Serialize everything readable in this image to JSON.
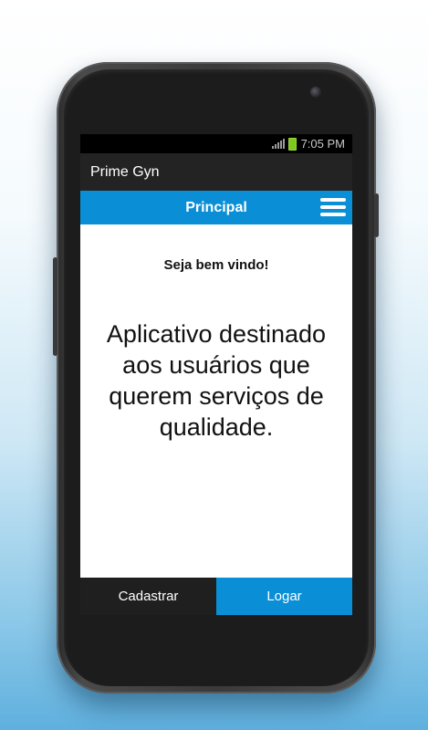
{
  "statusbar": {
    "time": "7:05 PM",
    "signal_icon": "signal-icon",
    "battery_icon": "battery-icon"
  },
  "appbar": {
    "title": "Prime Gyn"
  },
  "navbar": {
    "title": "Principal",
    "menu_icon": "hamburger-menu-icon"
  },
  "main": {
    "welcome": "Seja bem vindo!",
    "description": "Aplicativo destinado aos usuários que querem serviços de qualidade."
  },
  "footer": {
    "register_label": "Cadastrar",
    "login_label": "Logar"
  },
  "colors": {
    "accent": "#0a8fd6",
    "appbar": "#232323",
    "footer_dark": "#1f1f1f"
  }
}
